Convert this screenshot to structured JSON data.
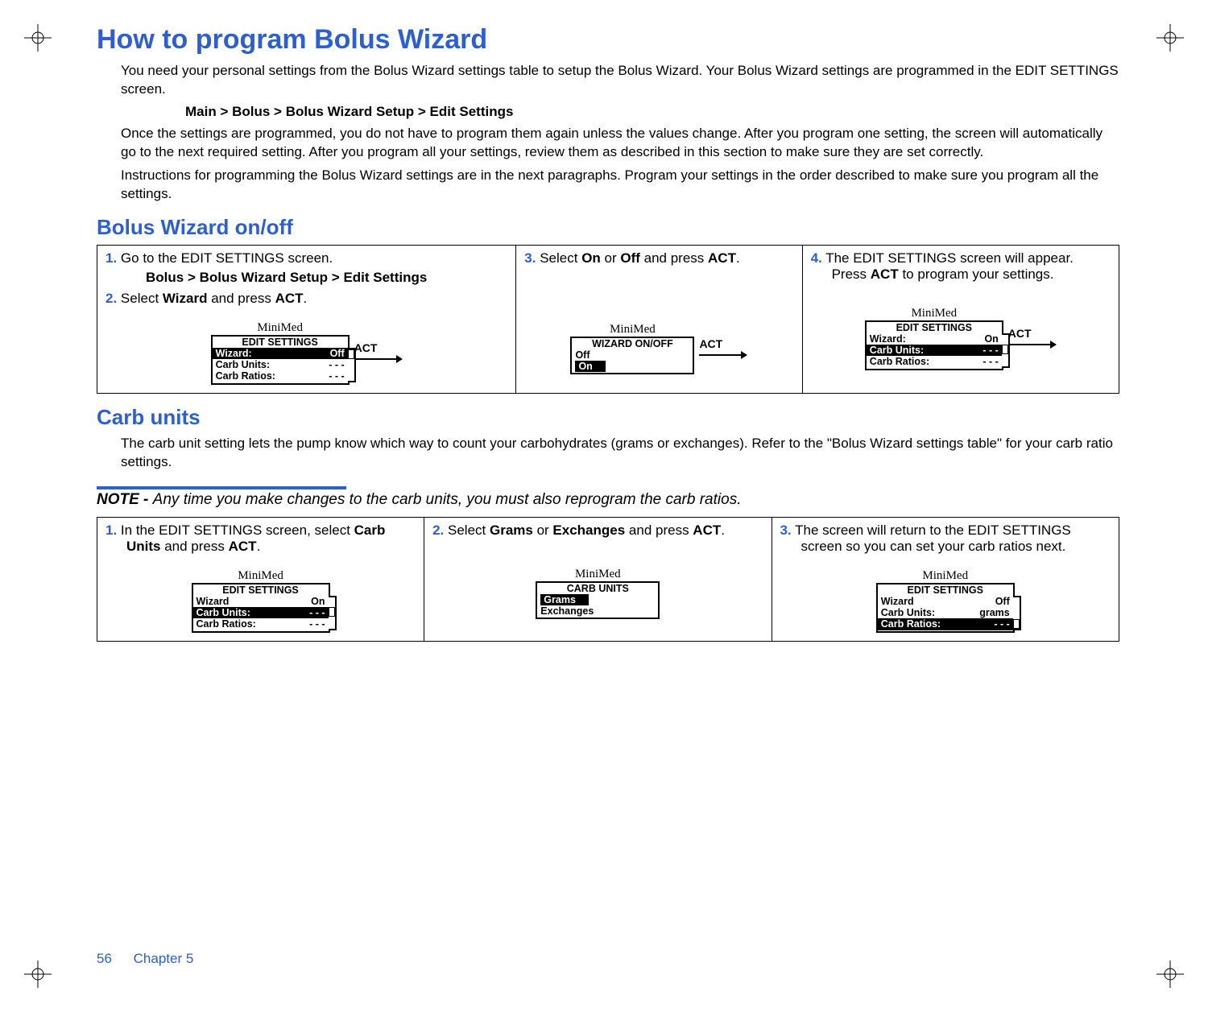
{
  "footer": {
    "page": "56",
    "chapter": "Chapter 5"
  },
  "h1": "How to program Bolus Wizard",
  "p1": "You need your personal settings from the Bolus Wizard settings table to setup the Bolus Wizard. Your Bolus Wizard settings are programmed in the EDIT SETTINGS screen.",
  "path1": "Main > Bolus > Bolus Wizard Setup > Edit Settings",
  "p2": "Once the settings are programmed, you do not have to program them again unless the values change. After you program one setting, the screen will automatically go to the next required setting. After you program all your settings, review them as described in this section to make sure they are set correctly.",
  "p3": "Instructions for programming the Bolus Wizard settings are in the next paragraphs. Program your settings in the order described to make sure you program all the settings.",
  "h2a": "Bolus Wizard on/off",
  "tableA": {
    "c1": {
      "s1": {
        "num": "1.",
        "text": "Go to the EDIT SETTINGS screen."
      },
      "path": "Bolus > Bolus Wizard Setup > Edit Settings",
      "s2": {
        "num": "2.",
        "pre": "Select ",
        "b": "Wizard",
        "mid": " and press ",
        "act": "ACT",
        "post": "."
      },
      "dev": {
        "brand": "MiniMed",
        "hdr": "EDIT SETTINGS",
        "r1": {
          "lab": "Wizard:",
          "val": "Off",
          "sel": true
        },
        "r2": {
          "lab": "Carb Units:",
          "val": "- - -"
        },
        "r3": {
          "lab": "Carb Ratios:",
          "val": "- - -"
        },
        "act": "ACT"
      }
    },
    "c2": {
      "s3": {
        "num": "3.",
        "pre": "Select ",
        "b1": "On",
        "or": " or ",
        "b2": "Off",
        "mid": " and press ",
        "act": "ACT",
        "post": "."
      },
      "dev": {
        "brand": "MiniMed",
        "hdr": "WIZARD ON/OFF",
        "r1": {
          "lab": "Off",
          "val": "",
          "sel": false
        },
        "r2": {
          "lab": "On",
          "val": "",
          "sel": true
        },
        "act": "ACT"
      }
    },
    "c3": {
      "s4": {
        "num": "4.",
        "pre": "The EDIT SETTINGS screen will appear. Press ",
        "act": "ACT",
        "post": " to program your settings."
      },
      "dev": {
        "brand": "MiniMed",
        "hdr": "EDIT SETTINGS",
        "r1": {
          "lab": "Wizard:",
          "val": "On"
        },
        "r2": {
          "lab": "Carb Units:",
          "val": "- - -",
          "sel": true
        },
        "r3": {
          "lab": "Carb Ratios:",
          "val": "- - -"
        },
        "act": "ACT"
      }
    }
  },
  "h2b": "Carb units",
  "p4": "The carb unit setting lets the pump know which way to count your carbohydrates (grams or exchanges). Refer to the \"Bolus Wizard settings table\" for your carb ratio settings.",
  "note": {
    "label": "NOTE - ",
    "text": "Any time you make changes to the carb units, you must also reprogram the carb ratios."
  },
  "tableB": {
    "c1": {
      "s1": {
        "num": "1.",
        "pre": "In the EDIT SETTINGS screen, select ",
        "b": "Carb Units",
        "mid": " and press ",
        "act": "ACT",
        "post": "."
      },
      "dev": {
        "brand": "MiniMed",
        "hdr": "EDIT SETTINGS",
        "r1": {
          "lab": "Wizard",
          "val": "On"
        },
        "r2": {
          "lab": "Carb Units:",
          "val": "- - -",
          "sel": true
        },
        "r3": {
          "lab": "Carb Ratios:",
          "val": "- - -"
        }
      }
    },
    "c2": {
      "s2": {
        "num": "2.",
        "pre": "Select ",
        "b1": "Grams",
        "or": " or ",
        "b2": "Exchanges",
        "mid": " and press ",
        "act": "ACT",
        "post": "."
      },
      "dev": {
        "brand": "MiniMed",
        "hdr": "CARB UNITS",
        "r1": {
          "lab": "Grams",
          "val": "",
          "sel": true
        },
        "r2": {
          "lab": "Exchanges",
          "val": ""
        }
      }
    },
    "c3": {
      "s3": {
        "num": "3.",
        "text": "The screen will return to the EDIT SETTINGS screen so you can set your carb ratios next."
      },
      "dev": {
        "brand": "MiniMed",
        "hdr": "EDIT SETTINGS",
        "r1": {
          "lab": "Wizard",
          "val": "Off"
        },
        "r2": {
          "lab": "Carb Units:",
          "val": "grams"
        },
        "r3": {
          "lab": "Carb Ratios:",
          "val": "- - -",
          "sel": true
        }
      }
    }
  }
}
